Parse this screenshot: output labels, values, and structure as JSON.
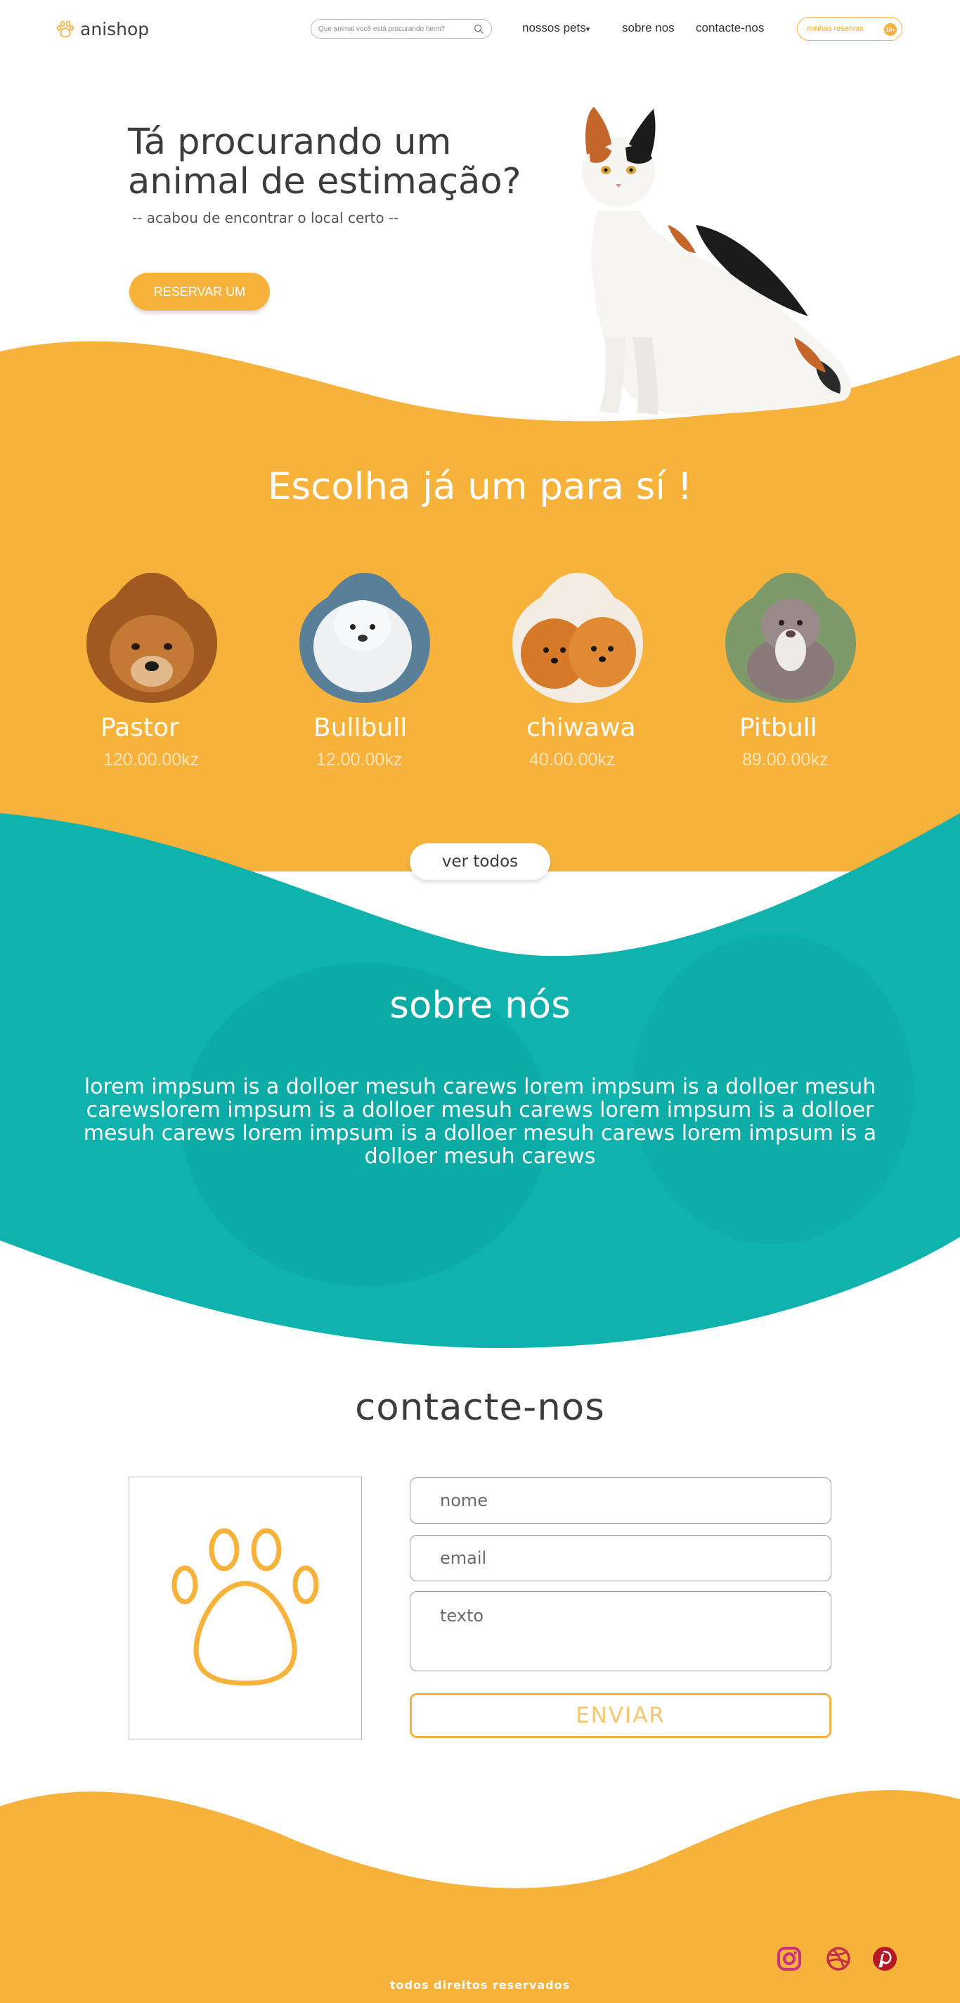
{
  "nav": {
    "logo_text": "anishop",
    "search_placeholder": "Que animal você está procurando heim?",
    "links": [
      {
        "label": "nossos pets"
      },
      {
        "label": "sobre nos"
      },
      {
        "label": "contacte-nos"
      }
    ],
    "reservations_label": "minhas reservas",
    "reservations_count": "10+"
  },
  "hero": {
    "title_line1": "Tá procurando um",
    "title_line2": "animal de estimação?",
    "subtitle": "-- acabou de encontrar o local certo --",
    "cta_label": "RESERVAR UM"
  },
  "pets": {
    "title": "Escolha já um para sí !",
    "items": [
      {
        "name": "Pastor",
        "price": "120.00.00kz"
      },
      {
        "name": "Bullbull",
        "price": "12.00.00kz"
      },
      {
        "name": "chiwawa",
        "price": "40.00.00kz"
      },
      {
        "name": "Pitbull",
        "price": "89.00.00kz"
      }
    ],
    "see_all_label": "ver todos"
  },
  "about": {
    "title": "sobre nós",
    "text": "lorem impsum is  a dolloer  mesuh carews lorem impsum is  a dolloer  mesuh carewslorem impsum is  a dolloer  mesuh carews lorem impsum is  a dolloer  mesuh carews lorem impsum is  a dolloer  mesuh carews lorem impsum is  a dolloer  mesuh carews"
  },
  "contact": {
    "title": "contacte-nos",
    "name_placeholder": "nome",
    "email_placeholder": "email",
    "text_placeholder": "texto",
    "send_label": "ENVIAR"
  },
  "footer": {
    "rights": "todos direitos reservados"
  },
  "colors": {
    "primary": "#f6b23a",
    "teal": "#0fb2ad",
    "social_instagram": "#c8327f",
    "social_dribbble": "#c22f47",
    "social_pinterest": "#b51a24"
  },
  "icons": [
    "paw-icon",
    "search-icon",
    "instagram-icon",
    "dribbble-icon",
    "pinterest-icon"
  ]
}
